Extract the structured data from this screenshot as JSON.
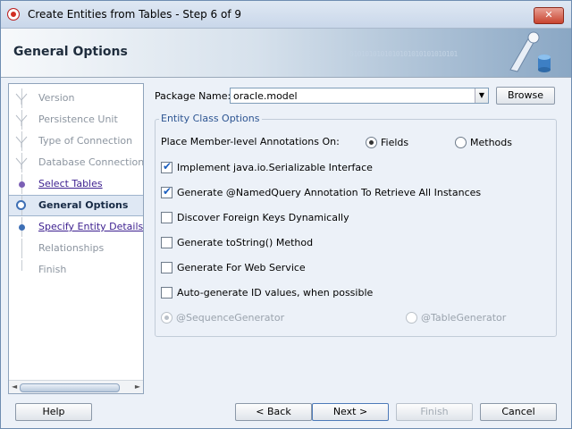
{
  "window": {
    "title": "Create Entities from Tables - Step 6 of 9",
    "close_glyph": "✕"
  },
  "banner": {
    "title": "General Options",
    "binary_text": "0101010101010101010101010101"
  },
  "nav": {
    "items": [
      {
        "label": "Version",
        "state": "done"
      },
      {
        "label": "Persistence Unit",
        "state": "done"
      },
      {
        "label": "Type of Connection",
        "state": "done"
      },
      {
        "label": "Database Connection De",
        "state": "done"
      },
      {
        "label": "Select Tables",
        "state": "link"
      },
      {
        "label": "General Options",
        "state": "current"
      },
      {
        "label": "Specify Entity Details",
        "state": "link"
      },
      {
        "label": "Relationships",
        "state": "future"
      },
      {
        "label": "Finish",
        "state": "future"
      }
    ],
    "scroll_left": "◄",
    "scroll_right": "►"
  },
  "package": {
    "label": "Package Name:",
    "value": "oracle.model",
    "drop_glyph": "▼",
    "browse_label": "Browse"
  },
  "entity_options": {
    "group_title": "Entity Class Options",
    "annotations_label": "Place Member-level Annotations On:",
    "radio_fields": {
      "label": "Fields",
      "selected": true
    },
    "radio_methods": {
      "label": "Methods",
      "selected": false
    },
    "checkboxes": [
      {
        "label": "Implement java.io.Serializable Interface",
        "checked": true
      },
      {
        "label": "Generate @NamedQuery Annotation To Retrieve All Instances",
        "checked": true
      },
      {
        "label": "Discover Foreign Keys Dynamically",
        "checked": false
      },
      {
        "label": "Generate toString() Method",
        "checked": false
      },
      {
        "label": "Generate For Web Service",
        "checked": false
      },
      {
        "label": "Auto-generate ID values, when possible",
        "checked": false
      }
    ],
    "radio_sequence": {
      "label": "@SequenceGenerator",
      "selected": true,
      "enabled": false
    },
    "radio_table": {
      "label": "@TableGenerator",
      "selected": false,
      "enabled": false
    }
  },
  "footer": {
    "help": "Help",
    "back": "< Back",
    "next": "Next >",
    "finish": "Finish",
    "cancel": "Cancel"
  },
  "check_glyph": "✔"
}
